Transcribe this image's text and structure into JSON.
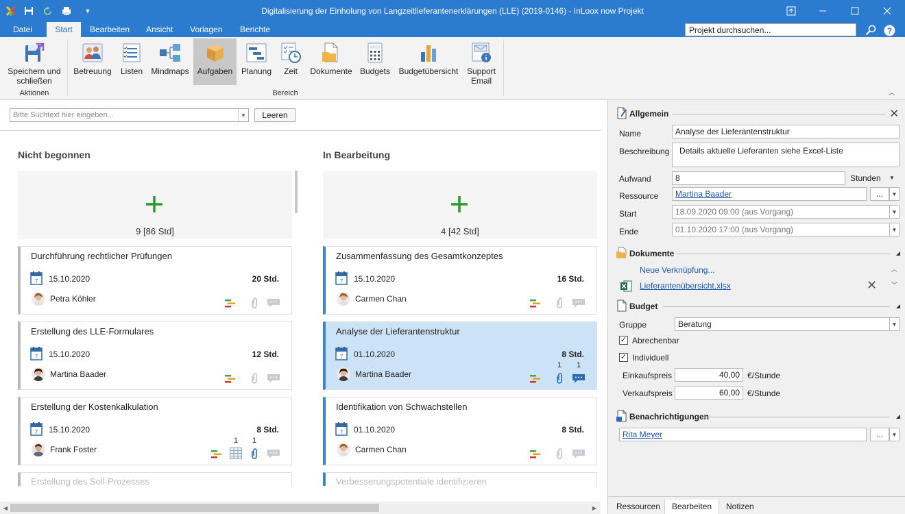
{
  "window": {
    "title": "Digitalisierung der Einholung von Langzeitlieferantenerklärungen (LLE) (2019-0146) - InLoox now Projekt"
  },
  "ribbon_tabs": [
    {
      "label": "Datei"
    },
    {
      "label": "Start"
    },
    {
      "label": "Bearbeiten"
    },
    {
      "label": "Ansicht"
    },
    {
      "label": "Vorlagen"
    },
    {
      "label": "Berichte"
    }
  ],
  "project_search": {
    "placeholder": "Projekt durchsuchen..."
  },
  "ribbon": {
    "save": {
      "line1": "Speichern und",
      "line2": "schließen"
    },
    "group_actions": "Aktionen",
    "group_area": "Bereich",
    "buttons": [
      {
        "label": "Betreuung"
      },
      {
        "label": "Listen"
      },
      {
        "label": "Mindmaps"
      },
      {
        "label": "Aufgaben"
      },
      {
        "label": "Planung"
      },
      {
        "label": "Zeit"
      },
      {
        "label": "Dokumente"
      },
      {
        "label": "Budgets"
      },
      {
        "label": "Budgetübersicht"
      },
      {
        "line1": "Support",
        "line2": "Email"
      }
    ]
  },
  "filter": {
    "placeholder": "Bitte Suchtext hier eingeben...",
    "clear_label": "Leeren"
  },
  "columns": [
    {
      "title": "Nicht begonnen",
      "summary": "9 [86 Std]",
      "cards": [
        {
          "title": "Durchführung rechtlicher Prüfungen",
          "date": "15.10.2020",
          "hours": "20 Std.",
          "person": "Petra Köhler"
        },
        {
          "title": "Erstellung des LLE-Formulares",
          "date": "15.10.2020",
          "hours": "12 Std.",
          "person": "Martina Baader"
        },
        {
          "title": "Erstellung der Kostenkalkulation",
          "date": "15.10.2020",
          "hours": "8 Std.",
          "person": "Frank Foster",
          "count_table": "1",
          "count_attach": "1"
        },
        {
          "title": "Erstellung des Soll-Prozesses"
        }
      ]
    },
    {
      "title": "In Bearbeitung",
      "summary": "4 [42 Std]",
      "cards": [
        {
          "title": "Zusammenfassung des Gesamtkonzeptes",
          "date": "15.10.2020",
          "hours": "16 Std.",
          "person": "Carmen Chan"
        },
        {
          "title": "Analyse der Lieferantenstruktur",
          "date": "01.10.2020",
          "hours": "8 Std.",
          "person": "Martina Baader",
          "count_attach": "1",
          "count_msg": "1"
        },
        {
          "title": "Identifikation von Schwachstellen",
          "date": "01.10.2020",
          "hours": "8 Std.",
          "person": "Carmen Chan"
        },
        {
          "title": "Verbesserungspotentiale identifizieren"
        }
      ]
    }
  ],
  "details": {
    "general": {
      "title": "Allgemein",
      "name_label": "Name",
      "name_value": "Analyse der Lieferantenstruktur",
      "desc_label": "Beschreibung",
      "desc_value": "Details aktuelle Lieferanten siehe Excel-Liste",
      "effort_label": "Aufwand",
      "effort_value": "8",
      "effort_unit": "Stunden",
      "resource_label": "Ressource",
      "resource_value": "Martina Baader",
      "start_label": "Start",
      "start_value": "18.09.2020 09:00 (aus Vorgang)",
      "end_label": "Ende",
      "end_value": "01.10.2020 17:00 (aus Vorgang)",
      "dots": "..."
    },
    "documents": {
      "title": "Dokumente",
      "new_link": "Neue Verknüpfung...",
      "file": "Lieferantenübersicht.xlsx"
    },
    "budget": {
      "title": "Budget",
      "group_label": "Gruppe",
      "group_value": "Beratung",
      "billable_label": "Abrechenbar",
      "individual_label": "Individuell",
      "purchase_label": "Einkaufspreis",
      "purchase_value": "40,00",
      "purchase_unit": "€/Stunde",
      "sales_label": "Verkaufspreis",
      "sales_value": "60,00",
      "sales_unit": "€/Stunde"
    },
    "notifications": {
      "title": "Benachrichtigungen",
      "person": "Rita Meyer",
      "dots": "..."
    }
  },
  "side_tabs": [
    {
      "label": "Ressourcen"
    },
    {
      "label": "Bearbeiten"
    },
    {
      "label": "Notizen"
    }
  ]
}
